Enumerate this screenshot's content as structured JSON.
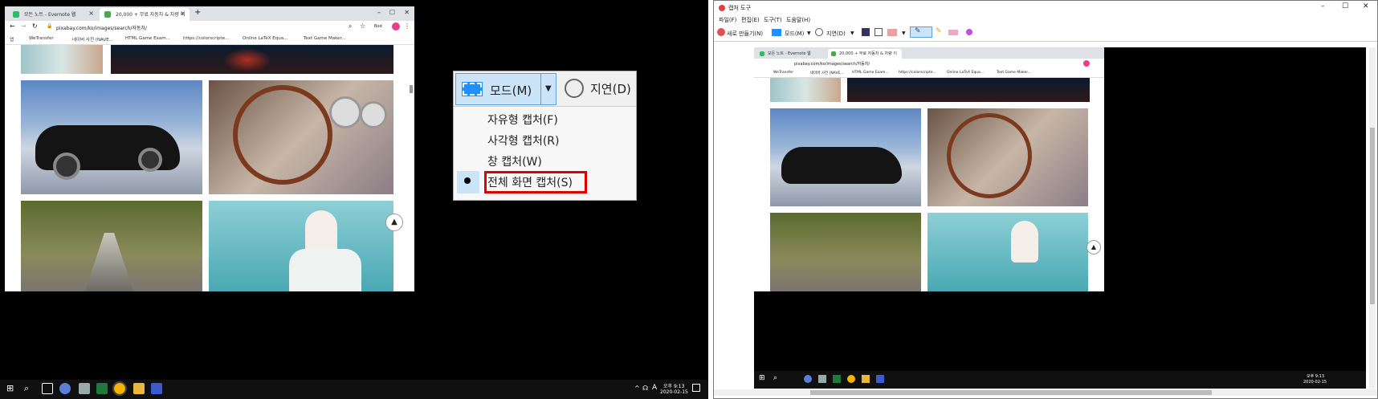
{
  "browser": {
    "tabs": [
      {
        "label": "모든 노트 - Evernote 웹",
        "active": false
      },
      {
        "label": "20,000 + 무료 자동차 & 차량 이",
        "active": true
      }
    ],
    "url": "pixabay.com/ko/images/search/자동차/",
    "bookmarks": [
      "앱",
      "WeTransfer",
      "네이버 사전 (NAVE...",
      "HTML Game Exam...",
      "https://colorscripte...",
      "Online LaTeX Equa...",
      "Text Game Maker..."
    ],
    "profile": "Bod"
  },
  "snip_popup": {
    "mode_label": "모드(M)",
    "delay_label": "지연(D)",
    "options": [
      "자유형 캡처(F)",
      "사각형 캡처(R)",
      "창 캡처(W)",
      "전체 화면 캡처(S)"
    ],
    "selected_index": 3,
    "highlight_color": "#e00000"
  },
  "taskbar": {
    "time": "오후 9:13",
    "date": "2020-02-15",
    "ime": "A",
    "volume": "☊"
  },
  "snipping_tool": {
    "title": "캡처 도구",
    "menu": [
      "파일(F)",
      "편집(E)",
      "도구(T)",
      "도움말(H)"
    ],
    "toolbar": {
      "new": "새로 만들기(N)",
      "mode": "모드(M)",
      "delay": "지연(D)"
    }
  },
  "colors": {
    "taskbar": "#101010",
    "accent": "#1e90ff",
    "popup_bg": "#f0f0f0"
  }
}
